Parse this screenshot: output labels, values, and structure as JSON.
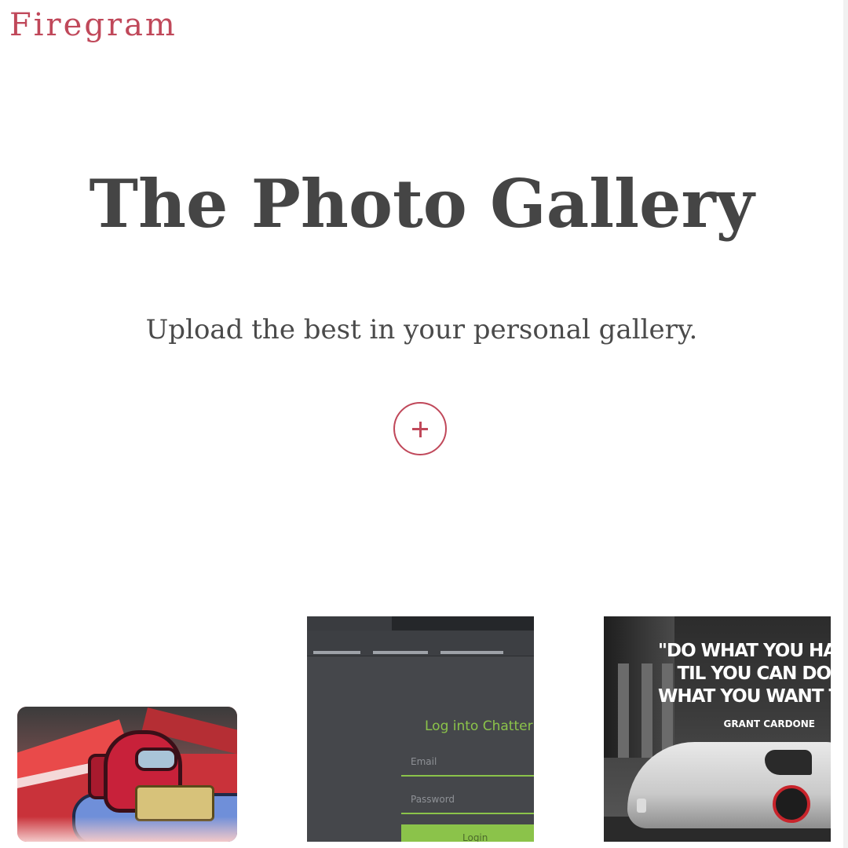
{
  "header": {
    "brand": "Firegram"
  },
  "hero": {
    "title": "The Photo Gallery",
    "subtitle": "Upload the best in your personal gallery.",
    "upload_icon": "plus-icon"
  },
  "colors": {
    "accent": "#c0485a",
    "title_text": "#454545",
    "login_green": "#8bc34a"
  },
  "gallery": {
    "images": [
      {
        "subject": "red cartoon character artwork"
      },
      {
        "subject": "login screen screenshot",
        "title": "Log into Chatter",
        "email_placeholder": "Email",
        "password_placeholder": "Password",
        "button_label": "Login"
      },
      {
        "subject": "motivational quote over car",
        "quote": "\"DO WHAT YOU HAVE\nTIL YOU CAN DO\nWHAT YOU WANT TO",
        "author": "GRANT CARDONE"
      }
    ]
  }
}
